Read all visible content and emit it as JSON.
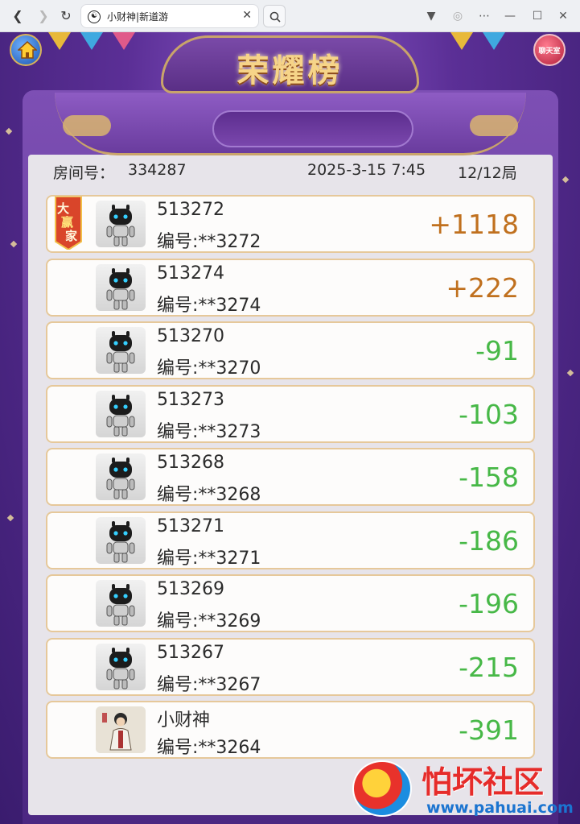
{
  "browser": {
    "tab_title": "小财神|新道游",
    "close_glyph": "✕"
  },
  "game": {
    "title": "荣耀榜",
    "chat_button": "聊天室",
    "room_label": "房间号：",
    "room_number": "334287",
    "datetime": "2025-3-15 7:45",
    "round": "12/12局",
    "winner_badge": "大赢家",
    "colors": {
      "positive": "#c0701e",
      "negative": "#47b847"
    }
  },
  "players": [
    {
      "name": "513272",
      "id_label": "编号:**3272",
      "score": "+1118",
      "positive": true,
      "winner": true,
      "avatar": "robot"
    },
    {
      "name": "513274",
      "id_label": "编号:**3274",
      "score": "+222",
      "positive": true,
      "winner": false,
      "avatar": "robot"
    },
    {
      "name": "513270",
      "id_label": "编号:**3270",
      "score": "-91",
      "positive": false,
      "winner": false,
      "avatar": "robot"
    },
    {
      "name": "513273",
      "id_label": "编号:**3273",
      "score": "-103",
      "positive": false,
      "winner": false,
      "avatar": "robot"
    },
    {
      "name": "513268",
      "id_label": "编号:**3268",
      "score": "-158",
      "positive": false,
      "winner": false,
      "avatar": "robot"
    },
    {
      "name": "513271",
      "id_label": "编号:**3271",
      "score": "-186",
      "positive": false,
      "winner": false,
      "avatar": "robot"
    },
    {
      "name": "513269",
      "id_label": "编号:**3269",
      "score": "-196",
      "positive": false,
      "winner": false,
      "avatar": "robot"
    },
    {
      "name": "513267",
      "id_label": "编号:**3267",
      "score": "-215",
      "positive": false,
      "winner": false,
      "avatar": "robot"
    },
    {
      "name": "小财神",
      "id_label": "编号:**3264",
      "score": "-391",
      "positive": false,
      "winner": false,
      "avatar": "person"
    }
  ],
  "watermark": {
    "text": "怕坏社区",
    "url": "www.pahuai.com"
  }
}
